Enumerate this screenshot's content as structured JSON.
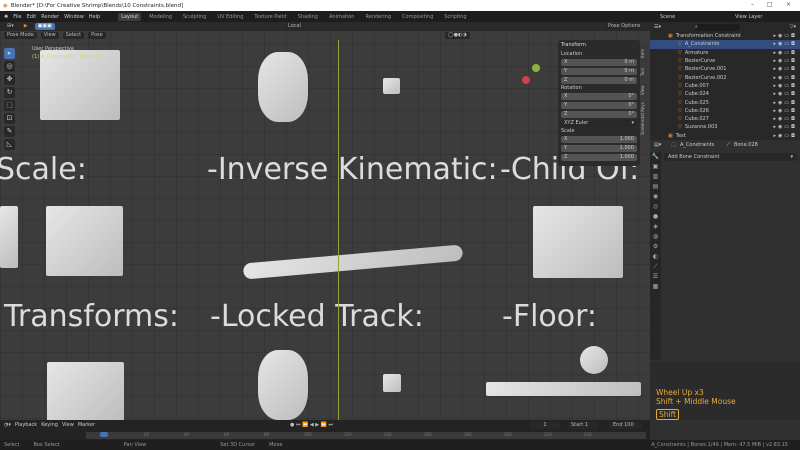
{
  "title": "Blender* [D:\\For Creative Shrimp\\Blends\\10 Constraints.blend]",
  "window_controls": [
    "–",
    "□",
    "×"
  ],
  "menu": [
    "File",
    "Edit",
    "Render",
    "Window",
    "Help"
  ],
  "workspaces": [
    "Layout",
    "Modeling",
    "Sculpting",
    "UV Editing",
    "Texture Paint",
    "Shading",
    "Animation",
    "Rendering",
    "Compositing",
    "Scripting"
  ],
  "scene": "Scene",
  "view_layer": "View Layer",
  "viewport": {
    "mode": "Pose Mode",
    "menus": [
      "View",
      "Select",
      "Pose"
    ],
    "orientation": "Local",
    "pose_options": "Pose Options",
    "info1": "User Perspective",
    "info2": "(1) A_Constraints : Bone.028",
    "labels": [
      "Scale:",
      "-Inverse Kinematic:",
      "-Child Of:",
      "Transforms:",
      "-Locked Track:",
      "-Floor:"
    ]
  },
  "npanel": {
    "header": "Transform",
    "location": "Location",
    "loc": [
      [
        "X",
        "0 m"
      ],
      [
        "Y",
        "0 m"
      ],
      [
        "Z",
        "0 m"
      ]
    ],
    "rotation": "Rotation",
    "rot": [
      [
        "X",
        "0°"
      ],
      [
        "Y",
        "0°"
      ],
      [
        "Z",
        "0°"
      ]
    ],
    "rot_mode": "XYZ Euler",
    "scale": "Scale",
    "scl": [
      [
        "X",
        "1.000"
      ],
      [
        "Y",
        "1.000"
      ],
      [
        "Z",
        "1.000"
      ]
    ],
    "tabs": [
      "Item",
      "Tool",
      "View",
      "Screencast Keys"
    ]
  },
  "outliner": {
    "rows": [
      "Transformation Constraint",
      "A_Constraints",
      "Armature",
      "BezierCurve",
      "BezierCurve.001",
      "BezierCurve.002",
      "Cube.007",
      "Cube.024",
      "Cube.025",
      "Cube.026",
      "Cube.027",
      "Suzanne.003",
      "Text"
    ]
  },
  "properties": {
    "object": "A_Constraints",
    "bone": "Bone.028",
    "add": "Add Bone Constraint"
  },
  "overlay": {
    "line1": "Wheel Up x3",
    "line2": "Shift + Middle Mouse",
    "key": "Shift"
  },
  "timeline": {
    "menus": [
      "Playback",
      "Keying",
      "View",
      "Marker"
    ],
    "frame": "1",
    "start_label": "Start",
    "start": "1",
    "end_label": "End",
    "end": "100",
    "ticks": [
      "0",
      "20",
      "40",
      "60",
      "80",
      "100",
      "120",
      "140",
      "160",
      "180",
      "200",
      "220",
      "240"
    ]
  },
  "status": {
    "items": [
      "Select",
      "Box Select",
      "Pan View",
      "Set 3D Cursor",
      "Move"
    ],
    "info": "A_Constraints | Bones:1/49 | Mem: 47.5 MiB | v2.83.15"
  }
}
